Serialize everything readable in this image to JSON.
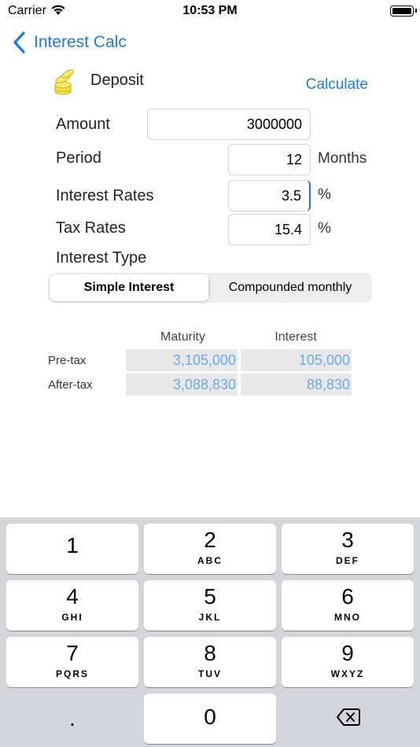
{
  "status_bar": {
    "carrier": "Carrier",
    "time": "10:53 PM"
  },
  "nav": {
    "back_label": "Interest Calc"
  },
  "header": {
    "title": "Deposit",
    "calculate_label": "Calculate"
  },
  "form": {
    "amount_label": "Amount",
    "amount_value": "3000000",
    "period_label": "Period",
    "period_value": "12",
    "period_unit": "Months",
    "rate_label": "Interest Rates",
    "rate_value": "3.5",
    "rate_unit": "%",
    "tax_label": "Tax Rates",
    "tax_value": "15.4",
    "tax_unit": "%",
    "type_label": "Interest Type"
  },
  "interest_type": {
    "options": [
      "Simple Interest",
      "Compounded monthly"
    ],
    "selected": "Simple Interest"
  },
  "results": {
    "columns": [
      "Maturity",
      "Interest"
    ],
    "rows": [
      {
        "label": "Pre-tax",
        "maturity": "3,105,000",
        "interest": "105,000"
      },
      {
        "label": "After-tax",
        "maturity": "3,088,830",
        "interest": "88,830"
      }
    ]
  },
  "keyboard": {
    "keys": [
      {
        "num": "1",
        "letters": ""
      },
      {
        "num": "2",
        "letters": "ABC"
      },
      {
        "num": "3",
        "letters": "DEF"
      },
      {
        "num": "4",
        "letters": "GHI"
      },
      {
        "num": "5",
        "letters": "JKL"
      },
      {
        "num": "6",
        "letters": "MNO"
      },
      {
        "num": "7",
        "letters": "PQRS"
      },
      {
        "num": "8",
        "letters": "TUV"
      },
      {
        "num": "9",
        "letters": "WXYZ"
      },
      {
        "num": "0",
        "letters": ""
      }
    ],
    "decimal": ".",
    "delete_icon": "delete-icon"
  },
  "colors": {
    "accent": "#1a7ae6",
    "result_text": "#6aa9ec",
    "keyboard_bg": "#d3d5da"
  }
}
